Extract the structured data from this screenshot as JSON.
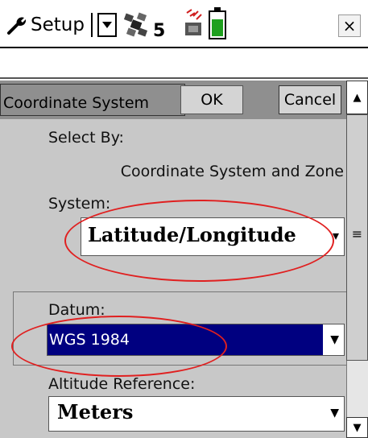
{
  "titlebar": {
    "app_label": "Setup",
    "satellite_count": "5",
    "close_label": "×"
  },
  "form": {
    "header_title": "Coordinate System",
    "ok_label": "OK",
    "cancel_label": "Cancel",
    "select_by_label": "Select By:",
    "select_by_value": "Coordinate System and Zone",
    "system_label": "System:",
    "system_value": "Latitude/Longitude",
    "datum_label": "Datum:",
    "datum_value": "WGS 1984",
    "altitude_label": "Altitude Reference:",
    "altitude_value": "Meters"
  },
  "icons": {
    "dropdown_arrow": "▾",
    "scroll_up": "▲",
    "scroll_down": "▼",
    "scroll_grip": "≡"
  },
  "colors": {
    "highlight_ellipse": "#e02020",
    "selection_background": "#000080"
  }
}
